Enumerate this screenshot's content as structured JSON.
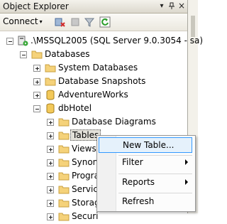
{
  "window": {
    "title": "Object Explorer",
    "pin_glyph": "▾",
    "autohide_glyph": "⊣",
    "close_glyph": "×"
  },
  "toolbar": {
    "connect_label": "Connect",
    "connect_arrow": "▾"
  },
  "tree": {
    "server": ".\\MSSQL2005 (SQL Server 9.0.3054 - sa)",
    "databases": "Databases",
    "system_databases": "System Databases",
    "database_snapshots": "Database Snapshots",
    "adventureworks": "AdventureWorks",
    "dbhotel": "dbHotel",
    "children": [
      {
        "label": "Database Diagrams"
      },
      {
        "label": "Tables"
      },
      {
        "label": "Views"
      },
      {
        "label": "Synon"
      },
      {
        "label": "Progra"
      },
      {
        "label": "Service"
      },
      {
        "label": "Storag"
      },
      {
        "label": "Securi"
      }
    ]
  },
  "context_menu": {
    "items": [
      {
        "label": "New Table..."
      },
      {
        "label": "Filter"
      },
      {
        "label": "Reports"
      },
      {
        "label": "Refresh"
      }
    ]
  }
}
